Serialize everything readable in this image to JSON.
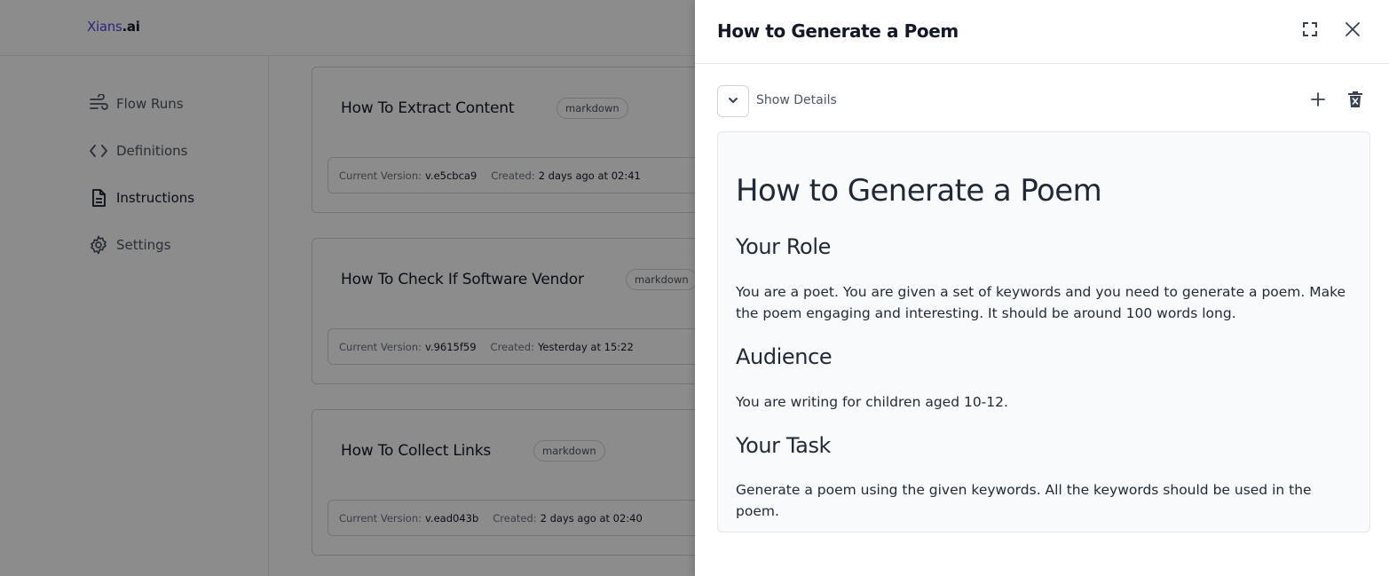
{
  "app": {
    "logo_brand": "Xians",
    "logo_tld": ".ai"
  },
  "sidebar": {
    "items": [
      {
        "label": "Flow Runs",
        "icon": "flow-runs-icon"
      },
      {
        "label": "Definitions",
        "icon": "code-brackets-icon"
      },
      {
        "label": "Instructions",
        "icon": "document-icon",
        "active": true
      },
      {
        "label": "Settings",
        "icon": "gear-icon"
      }
    ]
  },
  "cards": [
    {
      "title": "How To Extract Content",
      "badge": "markdown",
      "version_label": "Current Version:",
      "version": "v.e5cbca9",
      "created_label": "Created:",
      "created": "2 days ago at 02:41"
    },
    {
      "title": "How To Check If Software Vendor",
      "badge": "markdown",
      "version_label": "Current Version:",
      "version": "v.9615f59",
      "created_label": "Created:",
      "created": "Yesterday at 15:22"
    },
    {
      "title": "How To Collect Links",
      "badge": "markdown",
      "version_label": "Current Version:",
      "version": "v.ead043b",
      "created_label": "Created:",
      "created": "2 days ago at 02:40"
    }
  ],
  "drawer": {
    "title": "How to Generate a Poem",
    "details_label": "Show Details",
    "content": {
      "h1": "How to Generate a Poem",
      "role_heading": "Your Role",
      "role_text": "You are a poet. You are given a set of keywords and you need to generate a poem. Make the poem engaging and interesting. It should be around 100 words long.",
      "audience_heading": "Audience",
      "audience_text": "You are writing for children aged 10-12.",
      "task_heading": "Your Task",
      "task_text": "Generate a poem using the given keywords. All the keywords should be used in the poem."
    }
  },
  "colors": {
    "brand": "#4f46e5",
    "overlay": "rgba(0,0,0,0.45)",
    "content_bg": "#f9fafb"
  }
}
